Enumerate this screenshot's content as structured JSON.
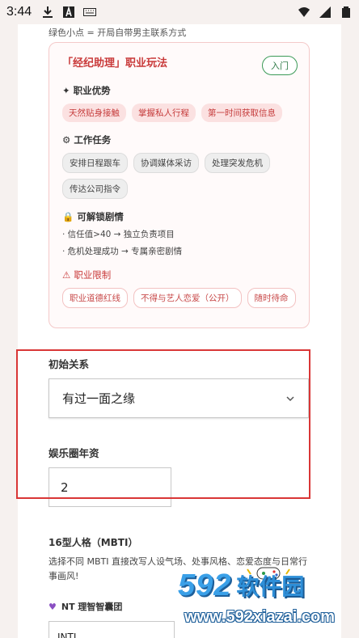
{
  "status_bar": {
    "time": "3:44"
  },
  "hint": "绿色小点 = 开局自带男主联系方式",
  "role_card": {
    "title": "「经纪助理」职业玩法",
    "entry_badge": "入门",
    "advantages_title": "职业优势",
    "advantages": [
      "天然贴身接触",
      "掌握私人行程",
      "第一时间获取信息"
    ],
    "tasks_title": "工作任务",
    "tasks": [
      "安排日程跟车",
      "协调媒体采访",
      "处理突发危机",
      "传达公司指令"
    ],
    "unlock_title": "可解锁剧情",
    "unlock_items": [
      "· 信任值>40 → 独立负责项目",
      "· 危机处理成功 → 专属亲密剧情"
    ],
    "limits_title": "职业限制",
    "limits": [
      "职业道德红线",
      "不得与艺人恋爱（公开）",
      "随时待命"
    ]
  },
  "relationship": {
    "label": "初始关系",
    "selected": "有过一面之缘"
  },
  "years": {
    "label": "娱乐圈年资",
    "value": "2"
  },
  "mbti": {
    "title": "16型人格（MBTI）",
    "description": "选择不同 MBTI 直接改写人设气场、处事风格、恋爱态度与日常行事画风!",
    "group": "NT 理智智囊团",
    "selected": "INTJ"
  },
  "watermark": {
    "logo_number": "592",
    "logo_text": "软件园",
    "url": "www.592xiazai.com"
  },
  "colors": {
    "accent_red": "#c93a3a",
    "badge_green": "#3b9a57",
    "highlight_box": "#d93636"
  }
}
